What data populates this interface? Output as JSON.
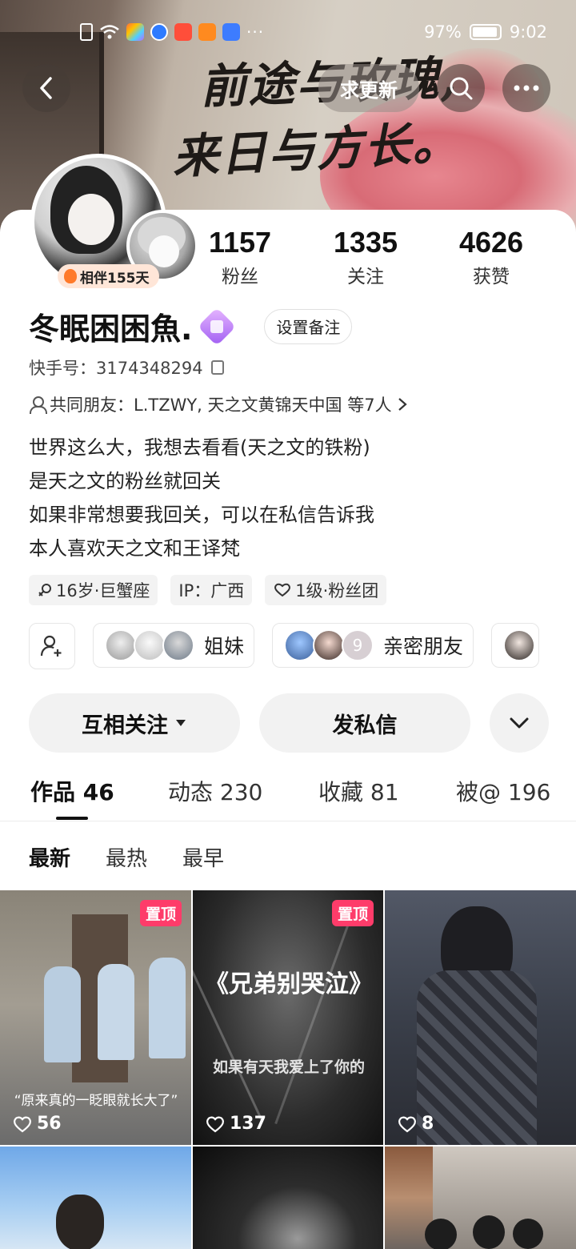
{
  "status": {
    "battery": "97%",
    "time": "9:02"
  },
  "cover": {
    "line1": "前途与玫瑰,",
    "line2": "来日与方长。"
  },
  "top": {
    "request_update": "求更新"
  },
  "profile": {
    "companion": "相伴155天",
    "stats": [
      {
        "value": "1157",
        "label": "粉丝"
      },
      {
        "value": "1335",
        "label": "关注"
      },
      {
        "value": "4626",
        "label": "获赞"
      }
    ],
    "name": "冬眠困困魚.",
    "remark_button": "设置备注",
    "kuaishou_id": "快手号：3174348294",
    "mutual_friends": "共同朋友：L.TZWY, 天之文黄锦天中国 等7人",
    "bio": [
      "世界这么大，我想去看看(天之文的铁粉)",
      "是天之文的粉丝就回关",
      "如果非常想要我回关，可以在私信告诉我",
      "本人喜欢天之文和王译梵"
    ],
    "tags": [
      {
        "icon": "gender-icon",
        "text": "16岁·巨蟹座"
      },
      {
        "icon": "",
        "text": "IP：广西"
      },
      {
        "icon": "fan-heart-icon",
        "text": "1级·粉丝团"
      }
    ],
    "groups": [
      {
        "label": "姐妹"
      },
      {
        "label": "亲密朋友",
        "count": "9"
      }
    ]
  },
  "actions": {
    "follow": "互相关注",
    "message": "发私信"
  },
  "tabs": [
    {
      "label": "作品 46"
    },
    {
      "label": "动态 230"
    },
    {
      "label": "收藏 81"
    },
    {
      "label": "被@ 196"
    }
  ],
  "sorts": [
    "最新",
    "最热",
    "最早"
  ],
  "videos": [
    {
      "pinned": "置顶",
      "likes": "56",
      "caption": "“原来真的一眨眼就长大了”"
    },
    {
      "pinned": "置顶",
      "likes": "137",
      "title": "《兄弟别哭泣》",
      "subtitle": "如果有天我爱上了你的"
    },
    {
      "likes": "8"
    }
  ],
  "colors": {
    "pin": "#fe3c6a",
    "badge": "#a05ef2",
    "companion_bg": "#ffe6d8"
  }
}
